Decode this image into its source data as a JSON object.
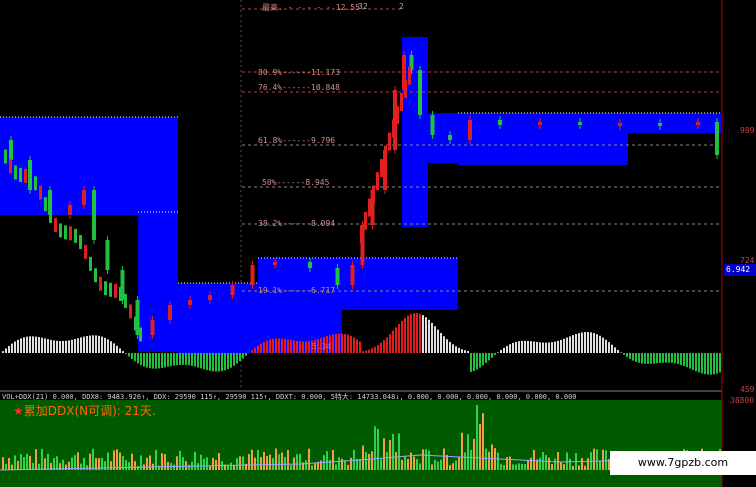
{
  "top": {
    "high_label": "最高",
    "high_value": "12.55",
    "count_a": "32",
    "count_b": "2"
  },
  "fib_levels": [
    {
      "pct": "80.9%",
      "price": "11.173"
    },
    {
      "pct": "76.4%",
      "price": "10.848"
    },
    {
      "pct": "61.8%",
      "price": "9.796"
    },
    {
      "pct": "50%",
      "price": "8.945"
    },
    {
      "pct": "38.2%",
      "price": "8.094"
    },
    {
      "pct": "19.1%",
      "price": "6.717"
    }
  ],
  "low_label": "5.34",
  "right_axis": {
    "v1": "989",
    "v2": "724",
    "current_price": "6.942",
    "v3": "459",
    "v4": "38800"
  },
  "status_line": "VOL+DDX(21) 0.000, DDX8: 9483.926↑, DDX: 29590 115↑, 29590 115↑, DDXT: 0.000, 5特大: 14733.048↓, 0.000, 0.000, 0.000, 0.000, 0.000, 0.000",
  "indicator_title": "累加DDX(N可调): 21天.",
  "indicator_star": "★",
  "watermark": "www.7gpzb.com",
  "colors": {
    "up": "#e02020",
    "down": "#20c040",
    "blue_block": "#0000ff",
    "green_panel": "#005a00"
  },
  "chart_data": {
    "type": "candlestick",
    "fib_retracement": [
      {
        "pct": 80.9,
        "price": 11.173
      },
      {
        "pct": 76.4,
        "price": 10.848
      },
      {
        "pct": 61.8,
        "price": 9.796
      },
      {
        "pct": 50,
        "price": 8.945
      },
      {
        "pct": 38.2,
        "price": 8.094
      },
      {
        "pct": 19.1,
        "price": 6.717
      }
    ],
    "high": 12.55,
    "low": 5.34,
    "current_price": 6.942,
    "indicator": "累加DDX",
    "indicator_period": 21
  }
}
